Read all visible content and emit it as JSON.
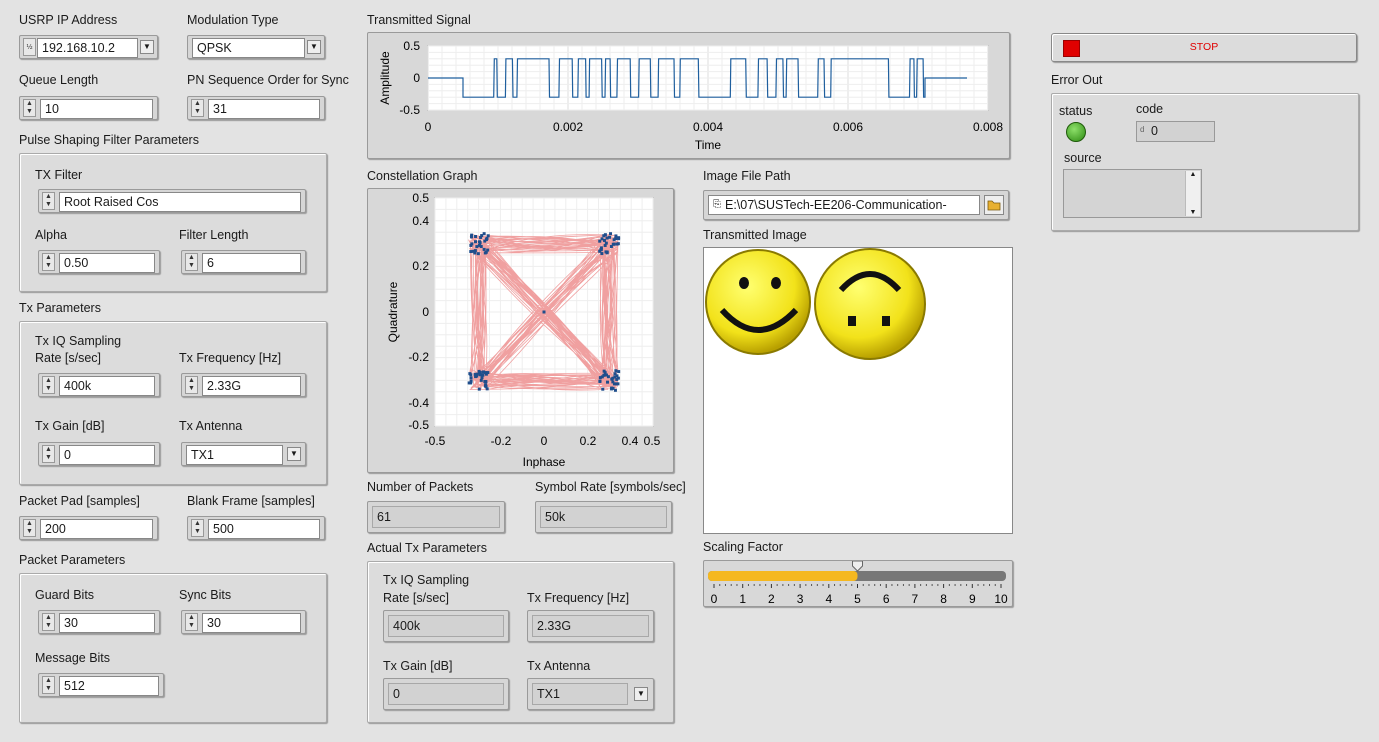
{
  "usrp": {
    "label": "USRP IP Address",
    "value": "192.168.10.2"
  },
  "modulation": {
    "label": "Modulation Type",
    "value": "QPSK"
  },
  "queue": {
    "label": "Queue Length",
    "value": "10"
  },
  "pn": {
    "label": "PN Sequence Order for Sync",
    "value": "31"
  },
  "pulse": {
    "label": "Pulse Shaping Filter Parameters",
    "tx_filter_label": "TX Filter",
    "tx_filter": "Root Raised Cos",
    "alpha_label": "Alpha",
    "alpha": "0.50",
    "filter_length_label": "Filter Length",
    "filter_length": "6"
  },
  "tx": {
    "label": "Tx Parameters",
    "iq_label_1": "Tx IQ Sampling",
    "iq_label_2": "Rate [s/sec]",
    "iq_rate": "400k",
    "freq_label": "Tx Frequency [Hz]",
    "freq": "2.33G",
    "gain_label": "Tx Gain [dB]",
    "gain": "0",
    "antenna_label": "Tx Antenna",
    "antenna": "TX1"
  },
  "packet_pad": {
    "label": "Packet Pad [samples]",
    "value": "200"
  },
  "blank_frame": {
    "label": "Blank Frame [samples]",
    "value": "500"
  },
  "packet": {
    "label": "Packet Parameters",
    "guard_label": "Guard Bits",
    "guard": "30",
    "sync_label": "Sync Bits",
    "sync": "30",
    "message_label": "Message Bits",
    "message": "512"
  },
  "transmitted_signal": {
    "title": "Transmitted Signal",
    "ylabel": "Amplitude",
    "xlabel": "Time",
    "yticks": [
      "0.5",
      "0",
      "-0.5"
    ],
    "xticks": [
      "0",
      "0.002",
      "0.004",
      "0.006",
      "0.008"
    ]
  },
  "constellation": {
    "title": "Constellation Graph",
    "xlabel": "Inphase",
    "ylabel": "Quadrature",
    "yticks": [
      "0.5",
      "0.4",
      "0.2",
      "0",
      "-0.2",
      "-0.4",
      "-0.5"
    ],
    "xticks": [
      "-0.5",
      "-0.2",
      "0",
      "0.2",
      "0.4",
      "0.5"
    ]
  },
  "image_path": {
    "label": "Image File Path",
    "value": "E:\\07\\SUSTech-EE206-Communication-"
  },
  "transmitted_image": {
    "label": "Transmitted Image"
  },
  "scaling": {
    "label": "Scaling Factor",
    "value": 5,
    "ticks": [
      "0",
      "1",
      "2",
      "3",
      "4",
      "5",
      "6",
      "7",
      "8",
      "9",
      "10"
    ]
  },
  "num_packets": {
    "label": "Number of Packets",
    "value": "61"
  },
  "symbol_rate": {
    "label": "Symbol Rate [symbols/sec]",
    "value": "50k"
  },
  "actual": {
    "label": "Actual Tx Parameters",
    "iq_label_1": "Tx IQ Sampling",
    "iq_label_2": "Rate [s/sec]",
    "iq_rate": "400k",
    "freq_label": "Tx Frequency [Hz]",
    "freq": "2.33G",
    "gain_label": "Tx Gain [dB]",
    "gain": "0",
    "antenna_label": "Tx Antenna",
    "antenna": "TX1"
  },
  "stop_label": "STOP",
  "error_out": {
    "label": "Error Out",
    "status_label": "status",
    "code_label": "code",
    "code": "0",
    "source_label": "source"
  },
  "colors": {
    "signal": "#1f5f9e",
    "trace": "#f0a0a0",
    "points": "#1f4e8c",
    "slider": "#f5b820",
    "led": "#3aa21a",
    "stop": "#e00000"
  },
  "chart_data": [
    {
      "type": "line",
      "title": "Transmitted Signal",
      "xlabel": "Time",
      "ylabel": "Amplitude",
      "xlim": [
        0,
        0.008
      ],
      "ylim": [
        -0.5,
        0.5
      ],
      "series": [
        {
          "values": "QPSK waveform toggling between approx -0.3 and 0.3, idle 0 outside 0.0005–0.0071"
        }
      ]
    },
    {
      "type": "scatter",
      "title": "Constellation Graph",
      "xlabel": "Inphase",
      "ylabel": "Quadrature",
      "xlim": [
        -0.5,
        0.5
      ],
      "ylim": [
        -0.5,
        0.5
      ],
      "series": [
        {
          "x": [
            -0.3,
            0.3,
            -0.3,
            0.3,
            0
          ],
          "y": [
            0.3,
            0.3,
            -0.3,
            -0.3,
            0
          ]
        }
      ]
    }
  ]
}
